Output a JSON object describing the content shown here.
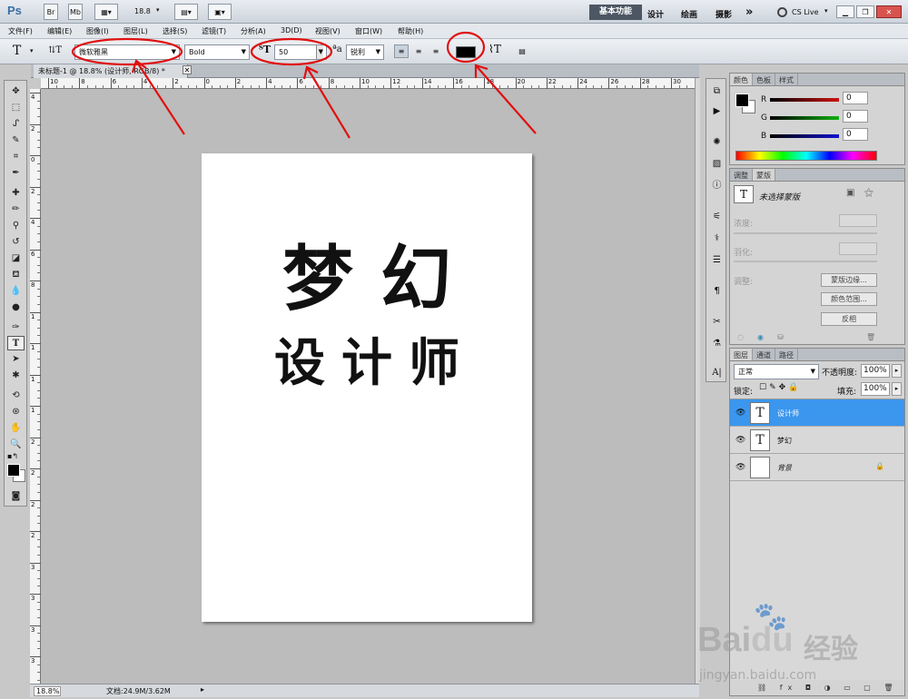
{
  "app": {
    "logo": "Ps",
    "zoom_label": "18.8",
    "workspace_button": "基本功能",
    "workspaces": [
      "设计",
      "绘画",
      "摄影"
    ],
    "more": "»",
    "cslive": "CS Live"
  },
  "menu": [
    "文件(F)",
    "编辑(E)",
    "图像(I)",
    "图层(L)",
    "选择(S)",
    "滤镜(T)",
    "分析(A)",
    "3D(D)",
    "视图(V)",
    "窗口(W)",
    "帮助(H)"
  ],
  "options": {
    "font_family": "微软雅黑",
    "font_style": "Bold",
    "font_size": "50",
    "antialias": "锐利",
    "text_color": "#000000"
  },
  "document": {
    "tab_title": "未标题-1 @ 18.8% (设计师, RGB/8) *",
    "line1": "梦幻",
    "line2": "设计师"
  },
  "ruler_h": [
    "10",
    "8",
    "6",
    "4",
    "2",
    "0",
    "2",
    "4",
    "6",
    "8",
    "10",
    "12",
    "14",
    "16",
    "18",
    "20",
    "22",
    "24",
    "26",
    "28",
    "30"
  ],
  "ruler_v": [
    "4",
    "2",
    "0",
    "2",
    "4",
    "6",
    "8",
    "1",
    "1",
    "1",
    "1",
    "2",
    "2",
    "2",
    "2",
    "3",
    "3",
    "3",
    "3"
  ],
  "status": {
    "zoom": "18.8%",
    "doc_info": "文档:24.9M/3.62M"
  },
  "color_panel": {
    "tabs": [
      "颜色",
      "色板",
      "样式"
    ],
    "channels": [
      {
        "name": "R",
        "value": "0",
        "color": "#d01010"
      },
      {
        "name": "G",
        "value": "0",
        "color": "#10b010"
      },
      {
        "name": "B",
        "value": "0",
        "color": "#1010d0"
      }
    ]
  },
  "adjust_panel": {
    "tabs": [
      "调整",
      "蒙版"
    ],
    "no_mask": "未选择蒙版",
    "density": "浓度:",
    "feather": "羽化:",
    "refine": "调整:",
    "buttons": [
      "蒙版边缘...",
      "颜色范围...",
      "反相"
    ]
  },
  "layers_panel": {
    "tabs": [
      "图层",
      "通道",
      "路径"
    ],
    "blend": "正常",
    "opacity_label": "不透明度:",
    "opacity": "100%",
    "lock_label": "锁定:",
    "fill_label": "填充:",
    "fill": "100%",
    "layers": [
      {
        "name": "设计师",
        "thumb": "T"
      },
      {
        "name": "梦幻",
        "thumb": "T"
      },
      {
        "name": "背景",
        "thumb": ""
      }
    ]
  },
  "watermark": {
    "brand": "Bai",
    "brand2": "du",
    "cn": "经验",
    "url": "jingyan.baidu.com"
  },
  "annotation_color": "#e01010"
}
